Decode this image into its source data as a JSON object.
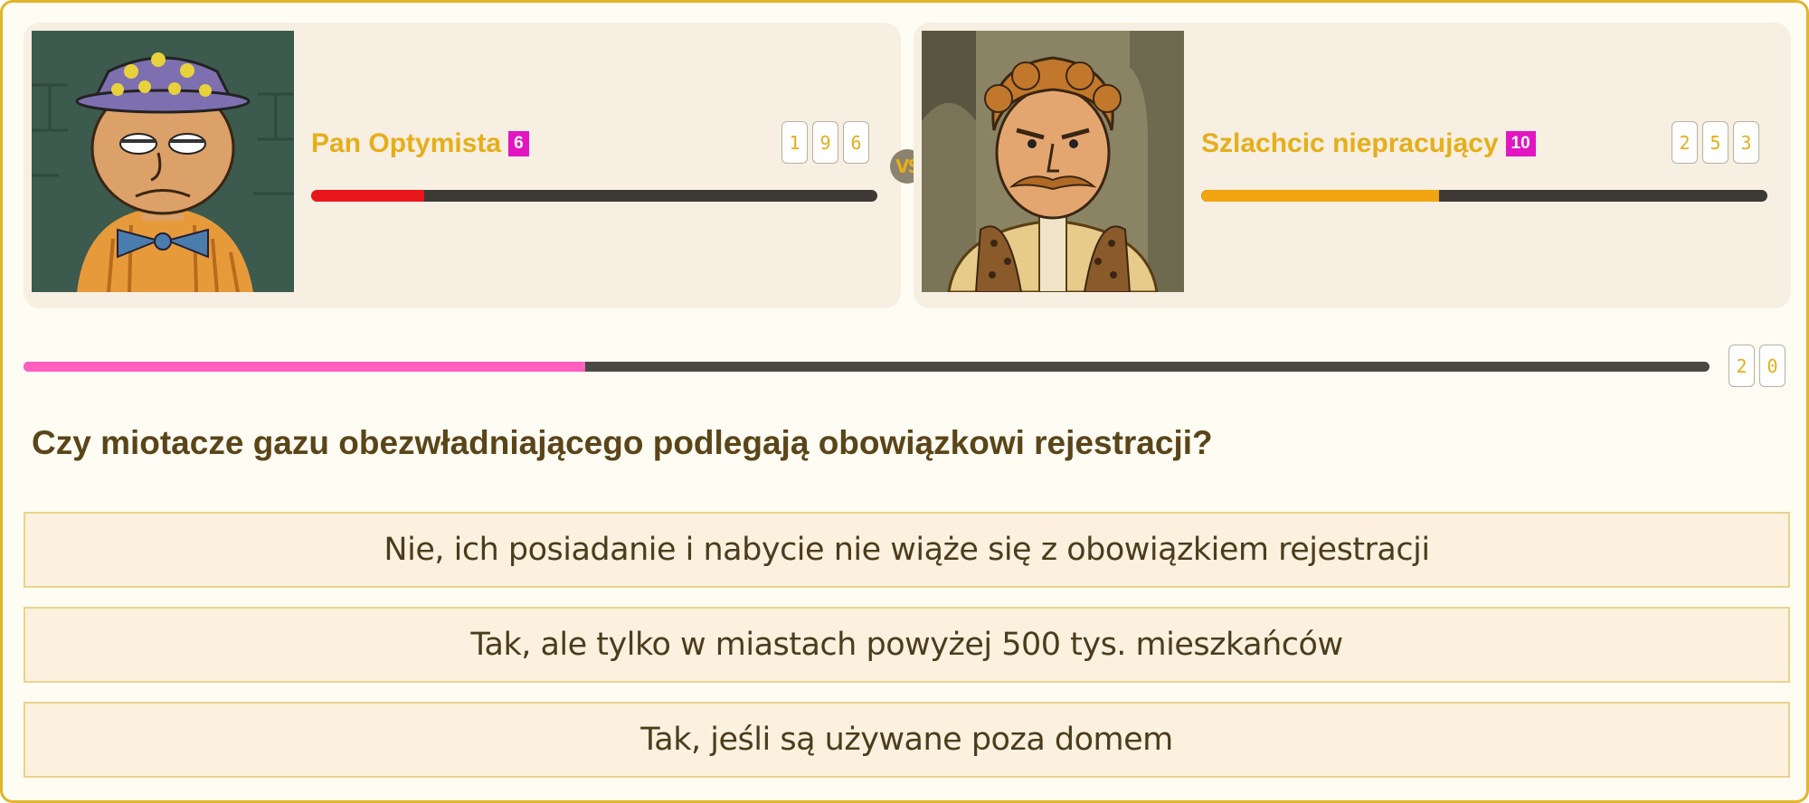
{
  "players": [
    {
      "name": "Pan Optymista",
      "level": "6",
      "score_digits": [
        "1",
        "9",
        "6"
      ],
      "hp_fraction": 0.2,
      "hp_color": "#e8161a"
    },
    {
      "name": "Szlachcic niepracujący",
      "level": "10",
      "score_digits": [
        "2",
        "5",
        "3"
      ],
      "hp_fraction": 0.42,
      "hp_color": "#f2a510"
    }
  ],
  "vs_label": "VS",
  "timer": {
    "digits": [
      "2",
      "0"
    ],
    "fraction": 0.333,
    "color": "#ff5fbf"
  },
  "question": "Czy miotacze gazu obezwładniającego podlegają obowiązkowi rejestracji?",
  "answers": [
    "Nie, ich posiadanie i nabycie nie wiąże się z obowiązkiem rejestracji",
    "Tak, ale tylko w miastach powyżej 500 tys. mieszkańców",
    "Tak, jeśli są używane poza domem"
  ],
  "colors": {
    "accent": "#e5ae1b",
    "level_badge": "#e314c2",
    "border": "#e0b52a"
  }
}
